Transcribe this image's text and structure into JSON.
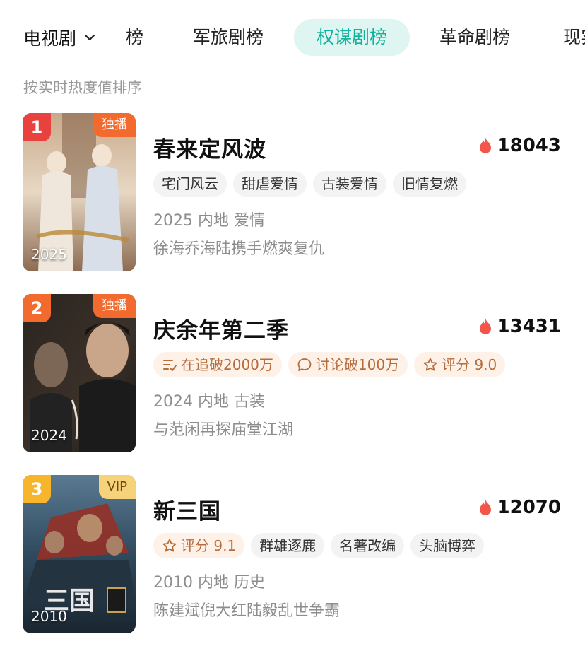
{
  "category": {
    "label": "电视剧"
  },
  "tabs": [
    {
      "label": "榜"
    },
    {
      "label": "军旅剧榜"
    },
    {
      "label": "权谋剧榜",
      "active": true
    },
    {
      "label": "革命剧榜"
    },
    {
      "label": "现实"
    }
  ],
  "subtitle": "按实时热度值排序",
  "items": [
    {
      "rank": "1",
      "badge": "独播",
      "year_overlay": "2025",
      "title": "春来定风波",
      "heat": "18043",
      "tags": [
        "宅门风云",
        "甜虐爱情",
        "古装爱情",
        "旧情复燃"
      ],
      "meta": "2025 内地 爱情",
      "desc": "徐海乔海陆携手燃爽复仇"
    },
    {
      "rank": "2",
      "badge": "独播",
      "year_overlay": "2024",
      "title": "庆余年第二季",
      "heat": "13431",
      "tags": [
        "在追破2000万",
        "讨论破100万",
        "评分 9.0"
      ],
      "meta": "2024 内地 古装",
      "desc": "与范闲再探庙堂江湖"
    },
    {
      "rank": "3",
      "badge": "VIP",
      "year_overlay": "2010",
      "title": "新三国",
      "heat": "12070",
      "tags": [
        "评分 9.1",
        "群雄逐鹿",
        "名著改编",
        "头脑博弈"
      ],
      "meta": "2010 内地 历史",
      "desc": "陈建斌倪大红陆毅乱世争霸"
    }
  ],
  "colors": {
    "accent": "#12b39c",
    "rank1": "#e8413e",
    "rank2": "#f26a2e",
    "rank3": "#f7b52c",
    "exclusive_badge": "#f26a2e",
    "vip_badge": "#f6d27a",
    "flame": "#f2564b"
  }
}
